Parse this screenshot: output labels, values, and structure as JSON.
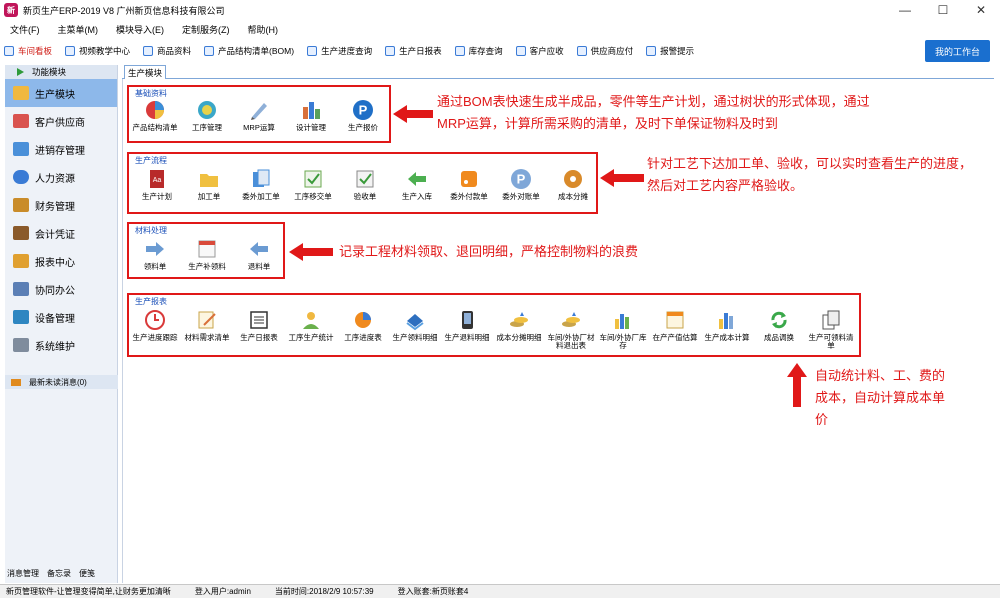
{
  "window": {
    "title": "新页生产ERP-2019 V8 广州新页信息科技有限公司",
    "logo": "新",
    "controls": [
      "minimize-icon",
      "maximize-icon",
      "close-icon"
    ]
  },
  "menu": [
    "文件(F)",
    "主菜单(M)",
    "模块导入(E)",
    "定制服务(Z)",
    "帮助(H)"
  ],
  "toolbar": {
    "items": [
      "车间看板",
      "视频教学中心",
      "商品资料",
      "产品结构清单(BOM)",
      "生产进度查询",
      "生产日报表",
      "库存查询",
      "客户应收",
      "供应商应付",
      "报警提示"
    ],
    "active_index": 0,
    "workbench_label": "我的工作台"
  },
  "sidebar": {
    "header": "功能模块",
    "items": [
      "生产模块",
      "客户供应商",
      "进销存管理",
      "人力资源",
      "财务管理",
      "会计凭证",
      "报表中心",
      "协同办公",
      "设备管理",
      "系统维护"
    ],
    "active_index": 0,
    "messages": "最新未读消息(0)",
    "bottom": [
      "消息管理",
      "备忘录",
      "便笺"
    ]
  },
  "tab": {
    "label": "生产模块"
  },
  "groups": {
    "basic": {
      "title": "基础资料",
      "tiles": [
        "产品结构清单",
        "工序管理",
        "MRP运算",
        "设计管理",
        "生产报价"
      ]
    },
    "flow": {
      "title": "生产流程",
      "tiles": [
        "生产计划",
        "加工单",
        "委外加工单",
        "工序移交单",
        "验收单",
        "生产入库",
        "委外付款单",
        "委外对账单",
        "成本分摊"
      ]
    },
    "material": {
      "title": "材料处理",
      "tiles": [
        "领料单",
        "生产补领料",
        "退料单"
      ]
    },
    "report": {
      "title": "生产报表",
      "tiles": [
        "生产进度跟踪",
        "材料需求清单",
        "生产日报表",
        "工序生产统计",
        "工序进度表",
        "生产领料明细",
        "生产退料明细",
        "成本分摊明细",
        "车间/外协厂材料退出表",
        "车间/外协厂库存",
        "在产产值估算",
        "生产成本计算",
        "成品调换",
        "生产可领料清单"
      ]
    }
  },
  "annotations": {
    "bom": [
      "通过BOM表快速生成半成品，零件等生产计划，通过树状的形式体现，通过",
      "MRP运算，计算所需采购的清单，及时下单保证物料及时到"
    ],
    "flow": [
      "针对工艺下达加工单、验收，可以实时查看生产的进度，",
      "然后对工艺内容严格验收。"
    ],
    "material": [
      "记录工程材料领取、退回明细，严格控制物料的浪费"
    ],
    "report": [
      "自动统计料、工、费的",
      "成本，自动计算成本单",
      "价"
    ]
  },
  "status": {
    "slogan": "新页管理软件-让管理变得简单,让财务更加清晰",
    "user": "登入用户:admin",
    "time": "当前时间:2018/2/9 10:57:39",
    "account": "登入账套:新页账套4"
  },
  "colors": {
    "accent": "#1a6fcf",
    "highlight_box": "#e01818",
    "annotation_text": "#e01818",
    "sidebar_active": "#8db8ea"
  }
}
